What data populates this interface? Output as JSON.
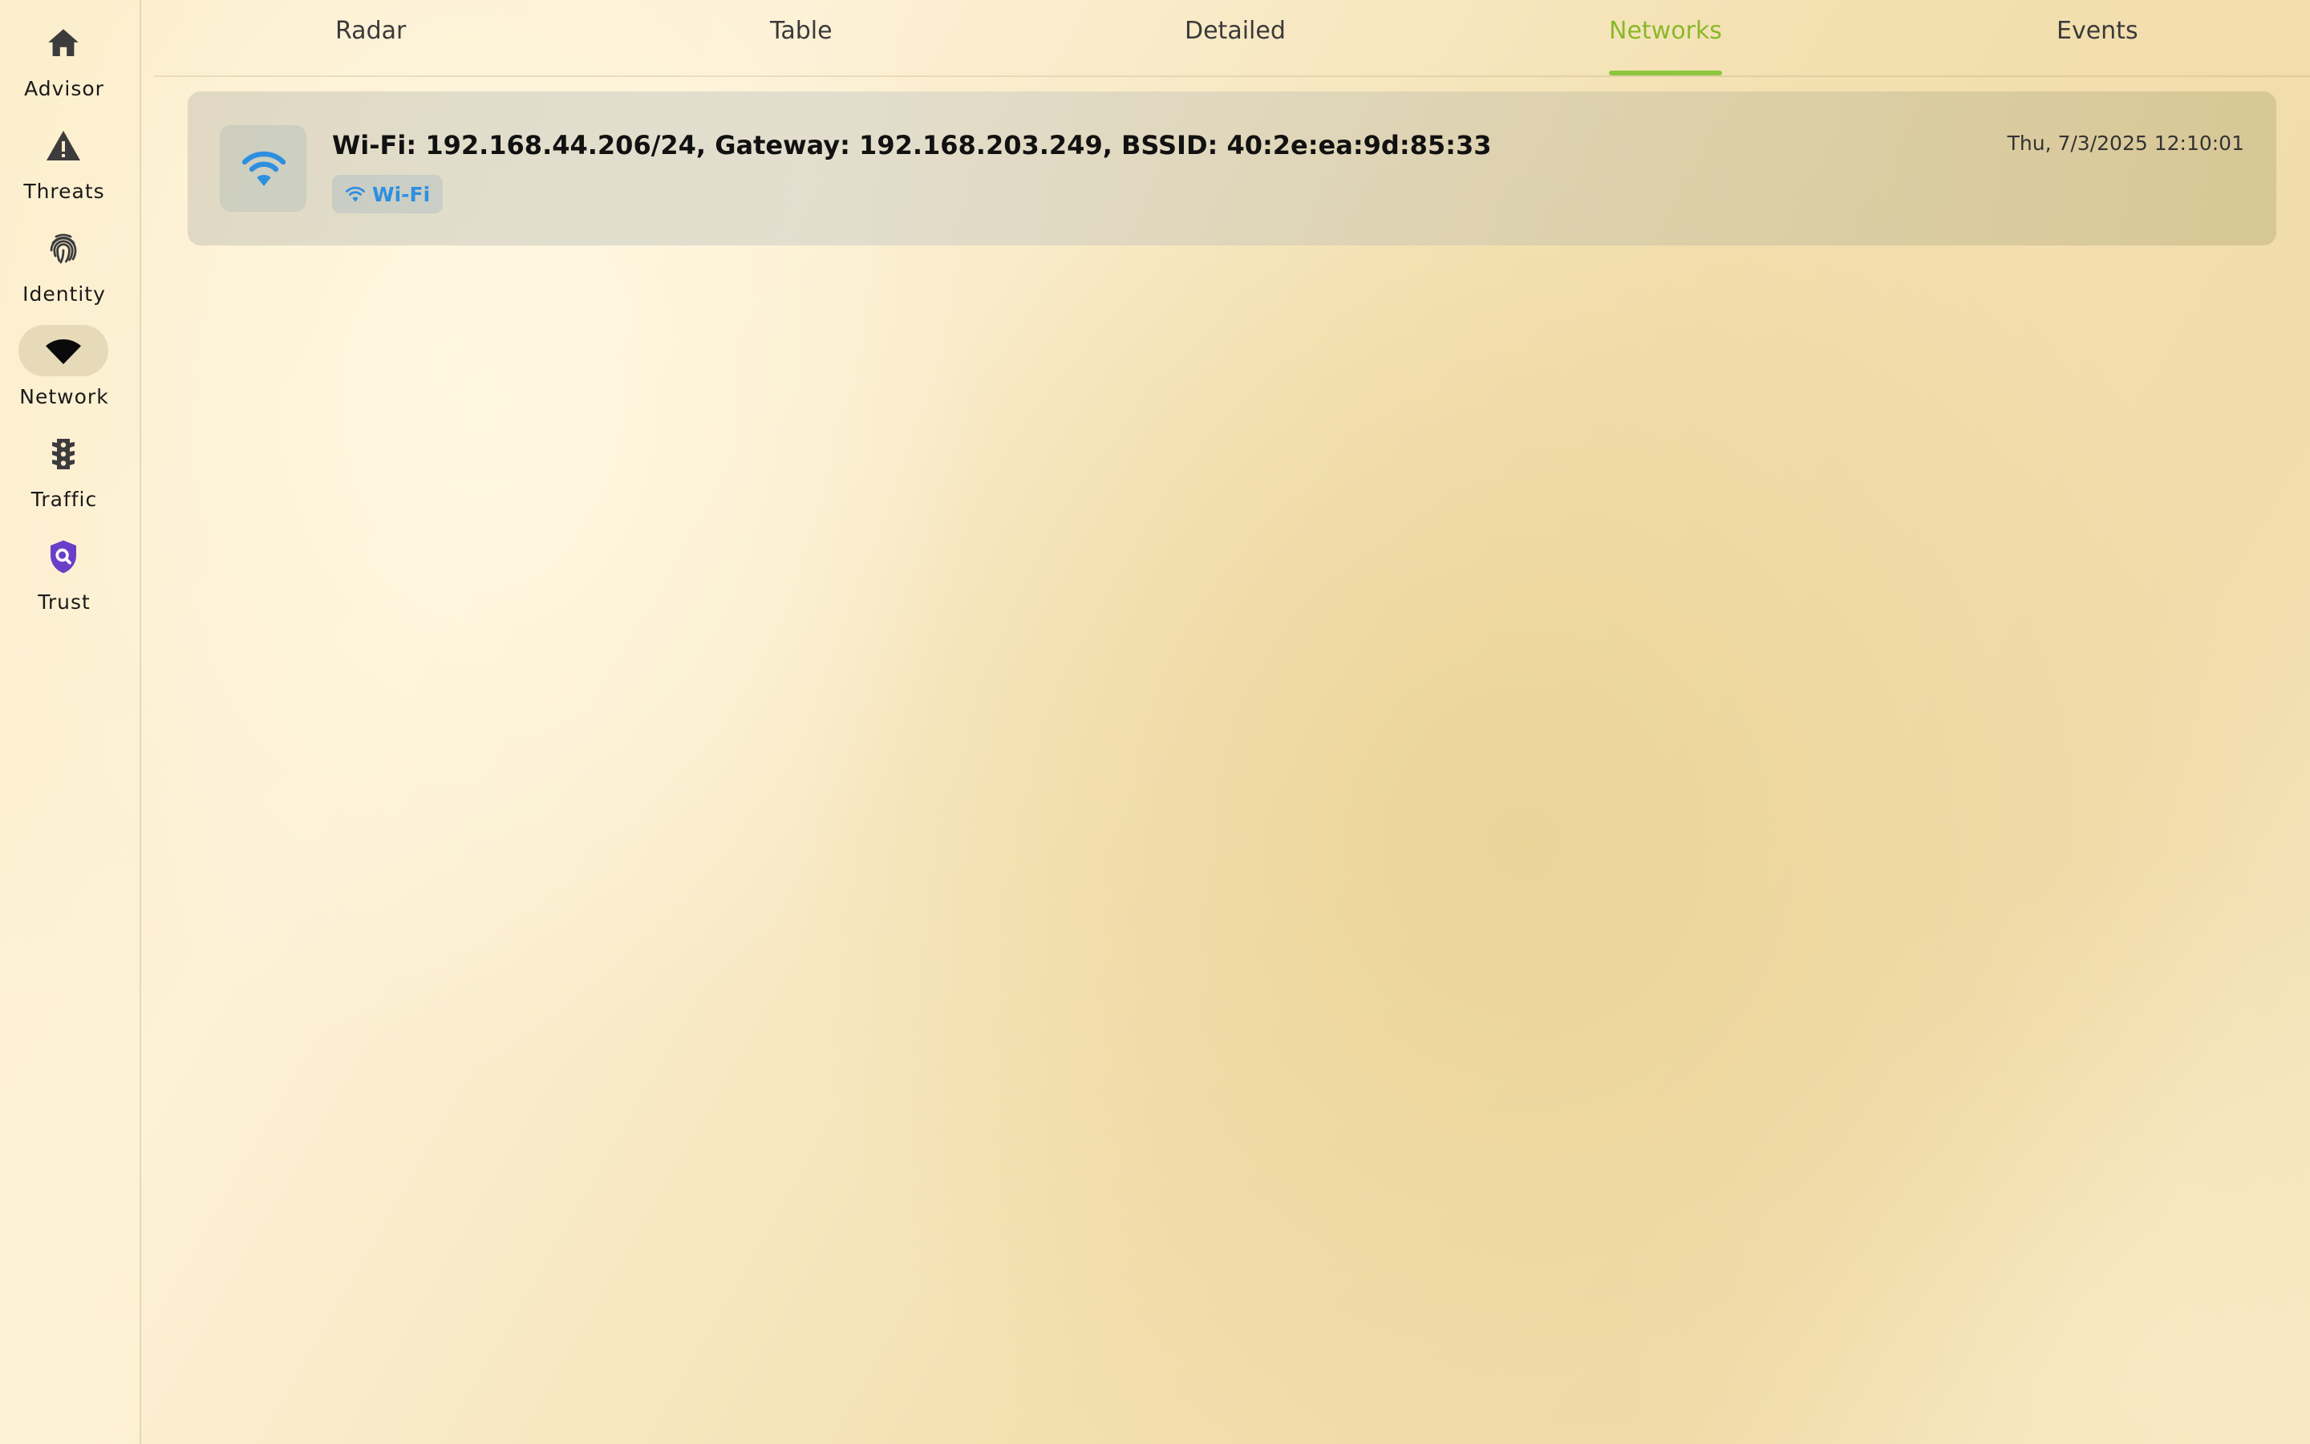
{
  "sidebar": {
    "items": [
      {
        "label": "Advisor",
        "icon": "home-icon",
        "active": false
      },
      {
        "label": "Threats",
        "icon": "warning-icon",
        "active": false
      },
      {
        "label": "Identity",
        "icon": "fingerprint-icon",
        "active": false
      },
      {
        "label": "Network",
        "icon": "wifi-icon",
        "active": true
      },
      {
        "label": "Traffic",
        "icon": "traffic-light-icon",
        "active": false
      },
      {
        "label": "Trust",
        "icon": "shield-search-icon",
        "active": false
      }
    ]
  },
  "tabs": {
    "items": [
      {
        "label": "Radar",
        "active": false
      },
      {
        "label": "Table",
        "active": false
      },
      {
        "label": "Detailed",
        "active": false
      },
      {
        "label": "Networks",
        "active": true
      },
      {
        "label": "Events",
        "active": false
      }
    ]
  },
  "networks": [
    {
      "title": "Wi-Fi: 192.168.44.206/24, Gateway: 192.168.203.249, BSSID: 40:2e:ea:9d:85:33",
      "timestamp": "Thu, 7/3/2025 12:10:01",
      "tag": "Wi-Fi",
      "icon": "wifi-icon"
    }
  ],
  "colors": {
    "accent": "#8cc63f",
    "wifi_blue": "#2e8fe0",
    "trust_purple": "#6a3fc8"
  }
}
